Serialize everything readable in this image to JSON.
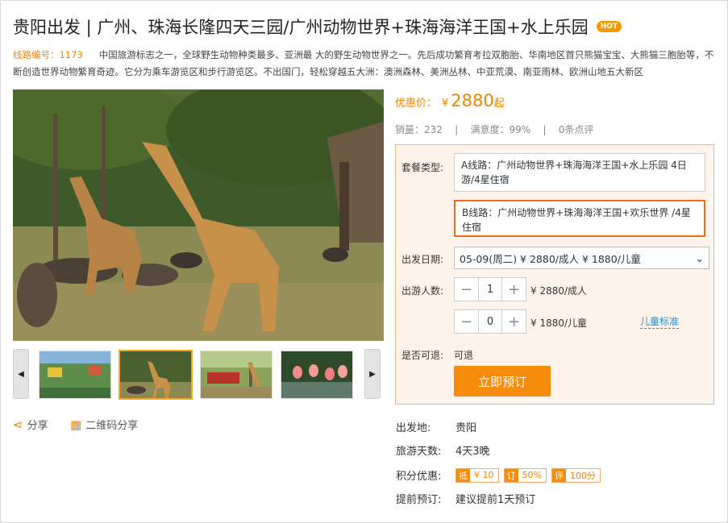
{
  "title": "贵阳出发 | 广州、珠海长隆四天三园/广州动物世界+珠海海洋王国+水上乐园",
  "hot_badge": "HOT",
  "route_code_label": "线路编号：1173",
  "description": "中国旅游标志之一，全球野生动物种类最多、亚洲最 大的野生动物世界之一。先后成功繁育考拉双胞胎、华南地区首只熊猫宝宝、大熊猫三胞胎等，不断创造世界动物繁育奇迹。它分为乘车游览区和步行游览区。不出国门，轻松穿越五大洲：澳洲森林、美洲丛林、中亚荒漠、南亚雨林、欧洲山地五大新区",
  "gallery": {
    "prev_icon": "◀",
    "next_icon": "▶"
  },
  "share": {
    "label": "分享",
    "qr_label": "二维码分享"
  },
  "price": {
    "label": "优惠价：",
    "currency": "¥",
    "amount": "2880",
    "suffix": "起"
  },
  "stats": {
    "sales": "销量：232",
    "satisfaction": "满意度：99%",
    "reviews": "0条点评",
    "sep": "|"
  },
  "booking": {
    "package_label": "套餐类型:",
    "options": [
      "A线路：广州动物世界+珠海海洋王国+水上乐园 4日游/4星住宿",
      "B线路：广州动物世界+珠海海洋王国+欢乐世界 /4星住宿"
    ],
    "date_label": "出发日期:",
    "date_value": "05-09(周二) ¥ 2880/成人  ¥ 1880/儿童",
    "people_label": "出游人数:",
    "adult_count": "1",
    "adult_price": "¥ 2880/成人",
    "child_count": "0",
    "child_price": "¥ 1880/儿童",
    "child_standard": "儿童标准",
    "minus": "−",
    "plus": "+",
    "refund_label": "是否可退:",
    "refund_value": "可退",
    "book_button": "立即预订"
  },
  "info": {
    "depart_label": "出发地:",
    "depart_value": "贵阳",
    "days_label": "旅游天数:",
    "days_value": "4天3晚",
    "points_label": "积分优惠:",
    "points_tags": [
      {
        "icon": "抵",
        "text": "¥ 10"
      },
      {
        "icon": "订",
        "text": "50%"
      },
      {
        "icon": "评",
        "text": "100分"
      }
    ],
    "advance_label": "提前预订:",
    "advance_value": "建议提前1天预订"
  },
  "colors": {
    "accent": "#f08300",
    "button": "#f78c0c",
    "selected_border": "#f06a1a",
    "link": "#1e8ed0"
  }
}
